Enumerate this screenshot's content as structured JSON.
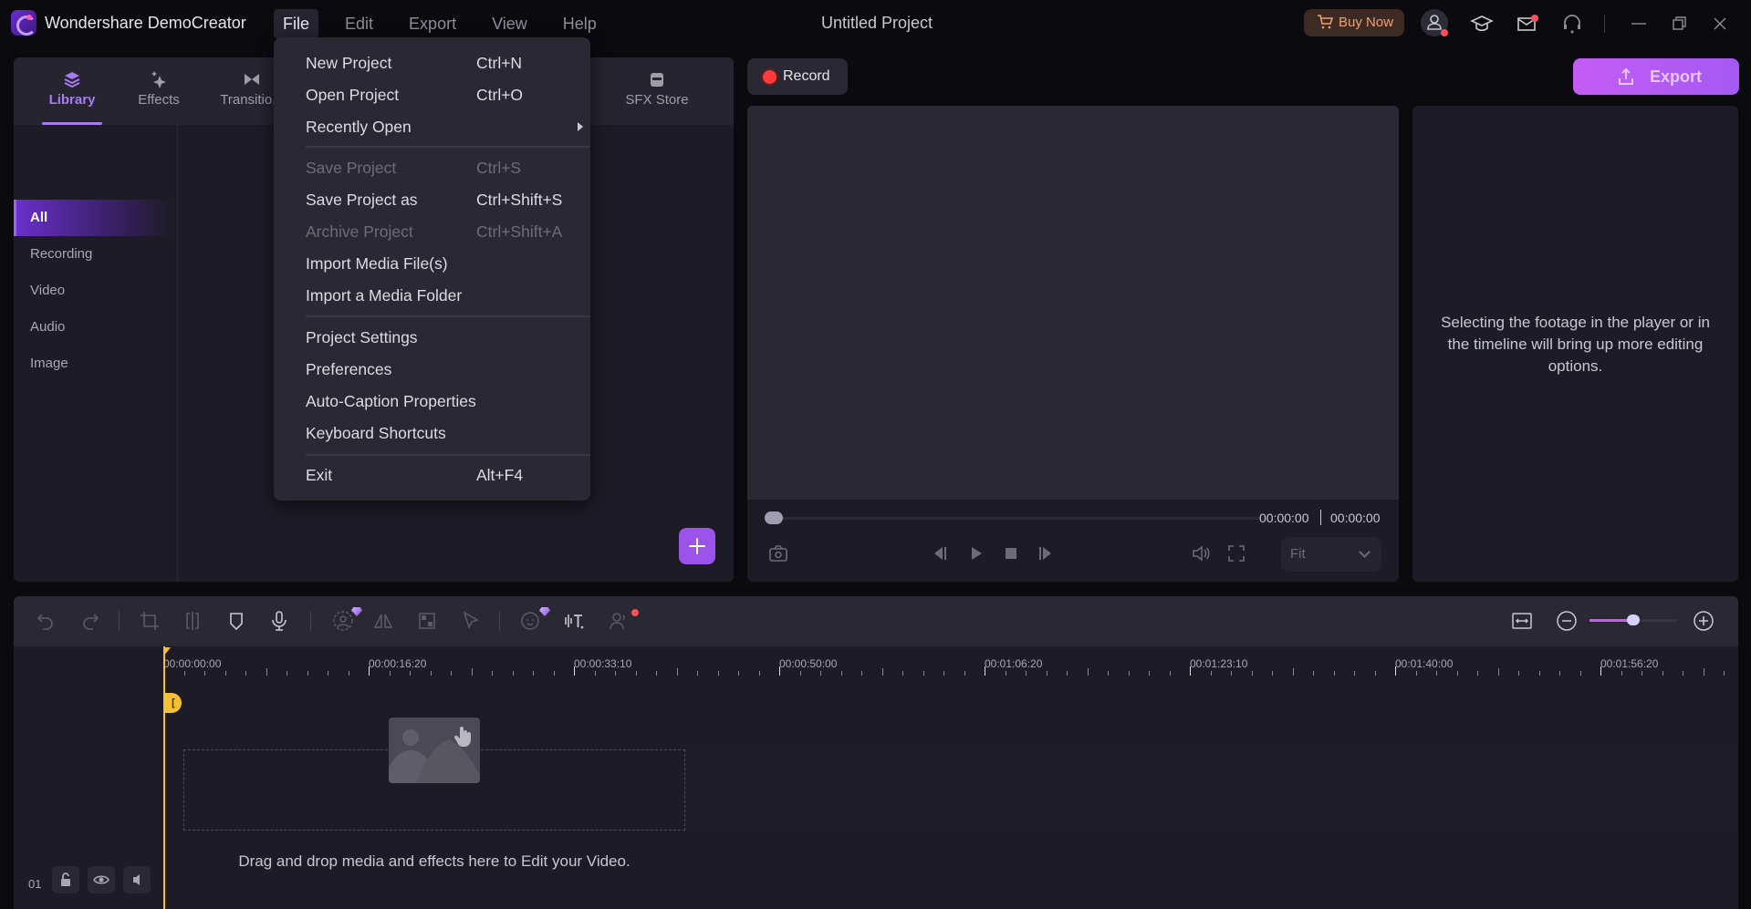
{
  "app": {
    "name": "Wondershare DemoCreator",
    "project_title": "Untitled Project",
    "menus": [
      {
        "label": "File",
        "active": true
      },
      {
        "label": "Edit"
      },
      {
        "label": "Export"
      },
      {
        "label": "View"
      },
      {
        "label": "Help"
      }
    ],
    "buy_now": "Buy Now",
    "header_icons": [
      "cart-icon",
      "user-icon",
      "academy-icon",
      "mail-icon",
      "support-icon",
      "minimize-icon",
      "restore-icon",
      "close-icon"
    ]
  },
  "file_menu": {
    "items": [
      {
        "label": "New Project",
        "shortcut": "Ctrl+N"
      },
      {
        "label": "Open Project",
        "shortcut": "Ctrl+O"
      },
      {
        "label": "Recently Open",
        "shortcut": "",
        "submenu": true
      },
      {
        "label": "Save Project",
        "shortcut": "Ctrl+S",
        "disabled": true
      },
      {
        "label": "Save Project as",
        "shortcut": "Ctrl+Shift+S"
      },
      {
        "label": "Archive Project",
        "shortcut": "Ctrl+Shift+A",
        "disabled": true
      },
      {
        "label": "Import Media File(s)",
        "shortcut": ""
      },
      {
        "label": "Import a Media Folder",
        "shortcut": ""
      },
      {
        "label": "Project Settings",
        "shortcut": ""
      },
      {
        "label": "Preferences",
        "shortcut": ""
      },
      {
        "label": "Auto-Caption Properties",
        "shortcut": ""
      },
      {
        "label": "Keyboard Shortcuts",
        "shortcut": ""
      },
      {
        "label": "Exit",
        "shortcut": "Alt+F4"
      }
    ]
  },
  "library": {
    "tabs": [
      {
        "label": "Library",
        "icon": "layers-icon",
        "active": true
      },
      {
        "label": "Effects",
        "icon": "sparkle-icon"
      },
      {
        "label": "Transitio...",
        "icon": "transition-icon"
      },
      {
        "label": "SFX Store",
        "icon": "store-icon"
      }
    ],
    "categories": [
      {
        "label": "All",
        "active": true
      },
      {
        "label": "Recording"
      },
      {
        "label": "Video"
      },
      {
        "label": "Audio"
      },
      {
        "label": "Image"
      }
    ]
  },
  "record_label": "Record",
  "export_label": "Export",
  "player": {
    "current_time": "00:00:00",
    "total_time": "00:00:00",
    "progress": 0,
    "fit": "Fit"
  },
  "properties": {
    "message": "Selecting the footage in the player or in the timeline will bring up more editing options."
  },
  "timeline": {
    "ruler_labels": [
      "00:00:00:00",
      "00:00:16:20",
      "00:00:33:10",
      "00:00:50:00",
      "00:01:06:20",
      "00:01:23:10",
      "00:01:40:00",
      "00:01:56:20"
    ],
    "zoom_level": 0.5,
    "track_number": "01",
    "drop_message": "Drag and drop media and effects here to Edit your Video."
  },
  "colors": {
    "accent": "#a77bf3",
    "export_gradient_start": "#c45cf5",
    "record_red": "#ff3b3b",
    "playhead": "#f5c033",
    "buy_now_text": "#f0a070"
  }
}
